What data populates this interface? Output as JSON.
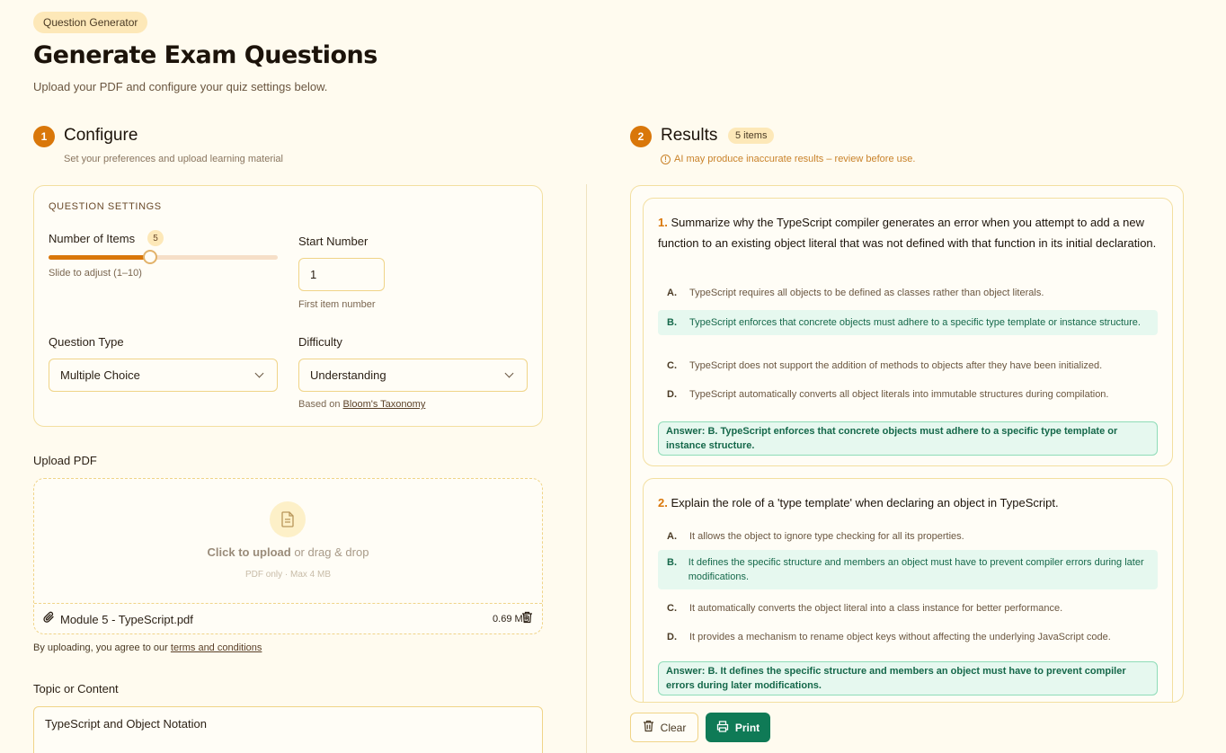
{
  "header": {
    "badge": "Question Generator",
    "title": "Generate Exam Questions",
    "subtitle": "Upload your PDF and configure your quiz settings below."
  },
  "configure": {
    "step": "1",
    "title": "Configure",
    "subtitle": "Set your preferences and upload learning material",
    "settings": {
      "section_label": "QUESTION SETTINGS",
      "number_of_items_label": "Number of Items",
      "number_of_items_value": "5",
      "slider_min": 1,
      "slider_max": 10,
      "slider_value": 5,
      "slider_hint": "Slide to adjust (1–10)",
      "start_number_label": "Start Number",
      "start_number_value": "1",
      "start_number_hint": "First item number",
      "question_type_label": "Question Type",
      "question_type_value": "Multiple Choice",
      "difficulty_label": "Difficulty",
      "difficulty_value": "Understanding",
      "difficulty_hint_prefix": "Based on ",
      "difficulty_hint_link": "Bloom's Taxonomy"
    },
    "upload": {
      "label": "Upload PDF",
      "click_text": "Click to upload",
      "drag_text": " or drag & drop",
      "limits": "PDF only · Max 4 MB",
      "file_name": "Module 5 - TypeScript.pdf",
      "file_size": "0.69 MB",
      "terms_prefix": "By uploading, you agree to our ",
      "terms_link": "terms and conditions"
    },
    "topic": {
      "label": "Topic or Content",
      "value": "TypeScript and Object Notation"
    }
  },
  "results": {
    "step": "2",
    "title": "Results",
    "count_badge": "5 items",
    "warning": "AI may produce inaccurate results – review before use.",
    "questions": [
      {
        "number": "1.",
        "text": "Summarize why the TypeScript compiler generates an error when you attempt to add a new function to an existing object literal that was not defined with that function in its initial declaration.",
        "options": [
          {
            "letter": "A.",
            "text": "TypeScript requires all objects to be defined as classes rather than object literals."
          },
          {
            "letter": "B.",
            "text": "TypeScript enforces that concrete objects must adhere to a specific type template or instance structure."
          },
          {
            "letter": "C.",
            "text": "TypeScript does not support the addition of methods to objects after they have been initialized."
          },
          {
            "letter": "D.",
            "text": "TypeScript automatically converts all object literals into immutable structures during compilation."
          }
        ],
        "answer": "Answer: B. TypeScript enforces that concrete objects must adhere to a specific type template or instance structure."
      },
      {
        "number": "2.",
        "text": "Explain the role of a 'type template' when declaring an object in TypeScript.",
        "options": [
          {
            "letter": "A.",
            "text": "It allows the object to ignore type checking for all its properties."
          },
          {
            "letter": "B.",
            "text": "It defines the specific structure and members an object must have to prevent compiler errors during later modifications."
          },
          {
            "letter": "C.",
            "text": "It automatically converts the object literal into a class instance for better performance."
          },
          {
            "letter": "D.",
            "text": "It provides a mechanism to rename object keys without affecting the underlying JavaScript code."
          }
        ],
        "answer": "Answer: B. It defines the specific structure and members an object must have to prevent compiler errors during later modifications."
      }
    ],
    "clear_label": "Clear",
    "print_label": "Print"
  },
  "colors": {
    "accent": "#d9770a",
    "background": "#fffbef",
    "success": "#0f7a56"
  },
  "icons": [
    "info-icon",
    "file-icon",
    "paperclip-icon",
    "trash-icon",
    "printer-icon",
    "chevron-down-icon"
  ]
}
